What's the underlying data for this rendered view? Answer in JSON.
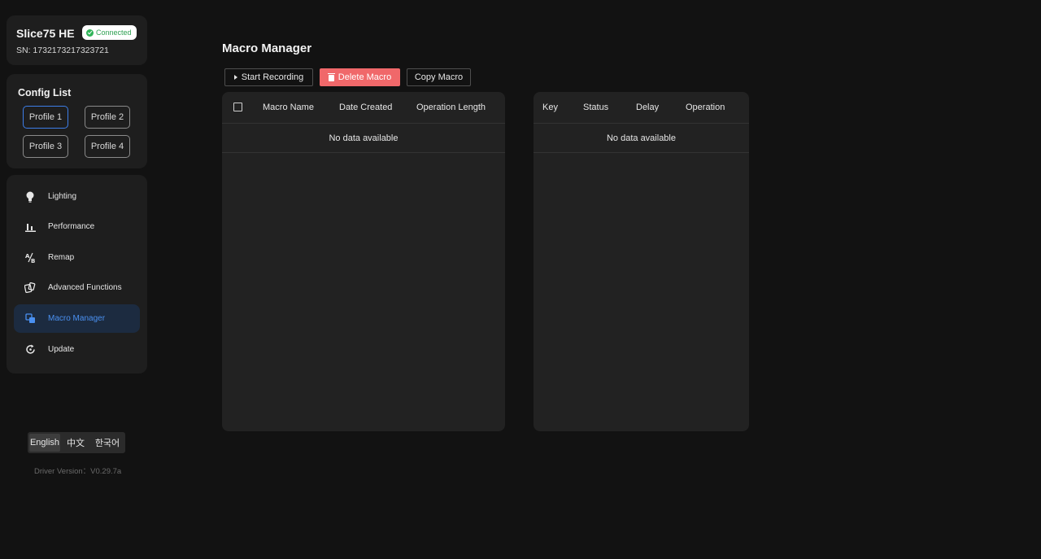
{
  "device": {
    "name": "Slice75 HE",
    "status": "Connected",
    "serial": "SN: 1732173217323721"
  },
  "config": {
    "title": "Config List",
    "profiles": [
      "Profile 1",
      "Profile 2",
      "Profile 3",
      "Profile 4"
    ],
    "active_profile": "Profile 1"
  },
  "nav": {
    "items": [
      {
        "label": "Lighting",
        "icon": "bulb-icon"
      },
      {
        "label": "Performance",
        "icon": "bar-chart-icon"
      },
      {
        "label": "Remap",
        "icon": "remap-icon"
      },
      {
        "label": "Advanced Functions",
        "icon": "cards-icon"
      },
      {
        "label": "Macro Manager",
        "icon": "macro-icon"
      },
      {
        "label": "Update",
        "icon": "refresh-icon"
      }
    ],
    "active": "Macro Manager"
  },
  "language": {
    "options": [
      "English",
      "中文",
      "한국어"
    ],
    "active": "English"
  },
  "driver_version": "Driver Version：V0.29.7a",
  "main": {
    "title": "Macro Manager",
    "toolbar": {
      "start_recording": "Start Recording",
      "delete_macro": "Delete Macro",
      "copy_macro": "Copy Macro"
    },
    "macro_table": {
      "columns": [
        "Macro Name",
        "Date Created",
        "Operation Length"
      ],
      "empty_text": "No data available"
    },
    "detail_table": {
      "columns": [
        "Key",
        "Status",
        "Delay",
        "Operation"
      ],
      "empty_text": "No data available"
    }
  },
  "colors": {
    "accent": "#3d7ee8",
    "danger": "#f0686a",
    "connected": "#2fb458",
    "background": "#121212",
    "card": "#1e1e1e"
  }
}
